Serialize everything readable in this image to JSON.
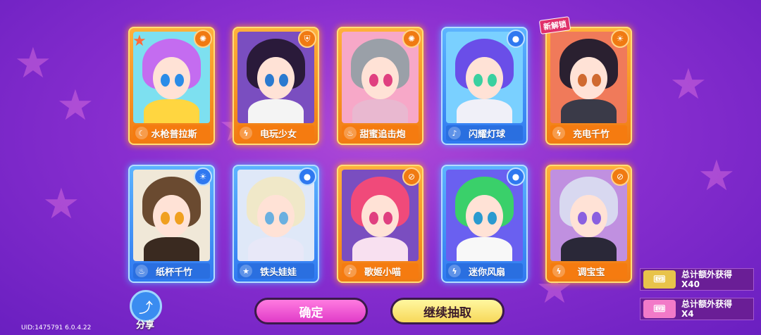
{
  "cards": [
    {
      "name": "水枪普拉斯",
      "rarity": "gold",
      "element_icon": "fire-icon",
      "type_icon": "moon-icon",
      "hair": "#c46cf0",
      "eyes": "#2a8ce8",
      "outfit": "#ffd640",
      "bg": "#7de0f0"
    },
    {
      "name": "电玩少女",
      "rarity": "gold",
      "element_icon": "shield-icon",
      "type_icon": "lightning-icon",
      "hair": "#2a1a3a",
      "eyes": "#2a7ad0",
      "outfit": "#f4f4f4",
      "bg": "#7a4ec0"
    },
    {
      "name": "甜蜜追击炮",
      "rarity": "gold",
      "element_icon": "fire-icon",
      "type_icon": "muffin-icon",
      "hair": "#9aa0a8",
      "eyes": "#e04080",
      "outfit": "#e9b8d0",
      "bg": "#f7a8c8"
    },
    {
      "name": "闪耀灯球",
      "rarity": "blue",
      "element_icon": "bomb-icon",
      "type_icon": "music-note-icon",
      "hair": "#6a4ee8",
      "eyes": "#3ad0a0",
      "outfit": "#f0f0f8",
      "bg": "#7ad0ff"
    },
    {
      "name": "充电千竹",
      "rarity": "gold",
      "element_icon": "sun-icon",
      "type_icon": "lightning-icon",
      "hair": "#2a2030",
      "eyes": "#d06a30",
      "outfit": "#3a3a48",
      "bg": "#f07a5a",
      "new_label": "新解锁"
    },
    {
      "name": "纸杯千竹",
      "rarity": "blue",
      "element_icon": "sun-icon",
      "type_icon": "muffin-icon",
      "hair": "#6a4a30",
      "eyes": "#f0a020",
      "outfit": "#3a2a20",
      "bg": "#f0e8d8"
    },
    {
      "name": "铁头娃娃",
      "rarity": "blue",
      "element_icon": "bomb-icon",
      "type_icon": "star-icon",
      "hair": "#f0e8c8",
      "eyes": "#6ab0e0",
      "outfit": "#e8e8f8",
      "bg": "#dfe8f8"
    },
    {
      "name": "歌姬小喵",
      "rarity": "gold",
      "element_icon": "banned-icon",
      "type_icon": "music-note-icon",
      "hair": "#f04a7a",
      "eyes": "#e04080",
      "outfit": "#f8e0f0",
      "bg": "#7a4ec0"
    },
    {
      "name": "迷你风扇",
      "rarity": "blue",
      "element_icon": "bomb-icon",
      "type_icon": "lightning-icon",
      "hair": "#3ad06a",
      "eyes": "#2a9ad0",
      "outfit": "#f8f8f8",
      "bg": "#6a60f0"
    },
    {
      "name": "调宝宝",
      "rarity": "gold",
      "element_icon": "banned-icon",
      "type_icon": "lightning-icon",
      "hair": "#d8d8f0",
      "eyes": "#8a60e0",
      "outfit": "#2a2838",
      "bg": "#c090e0"
    }
  ],
  "share_label": "分享",
  "confirm_label": "确定",
  "continue_label": "继续抽取",
  "bonus": [
    {
      "label": "总计额外获得",
      "count": "X40",
      "ticket_color": "#e8c34a"
    },
    {
      "label": "总计额外获得",
      "count": "X4",
      "ticket_color": "#f27ac8"
    }
  ],
  "uid_text": "UID:1475791 6.0.4.22",
  "colors": {
    "bg": "#8a2fd0",
    "gold": "#f57b10",
    "blue": "#2a6fe0"
  }
}
